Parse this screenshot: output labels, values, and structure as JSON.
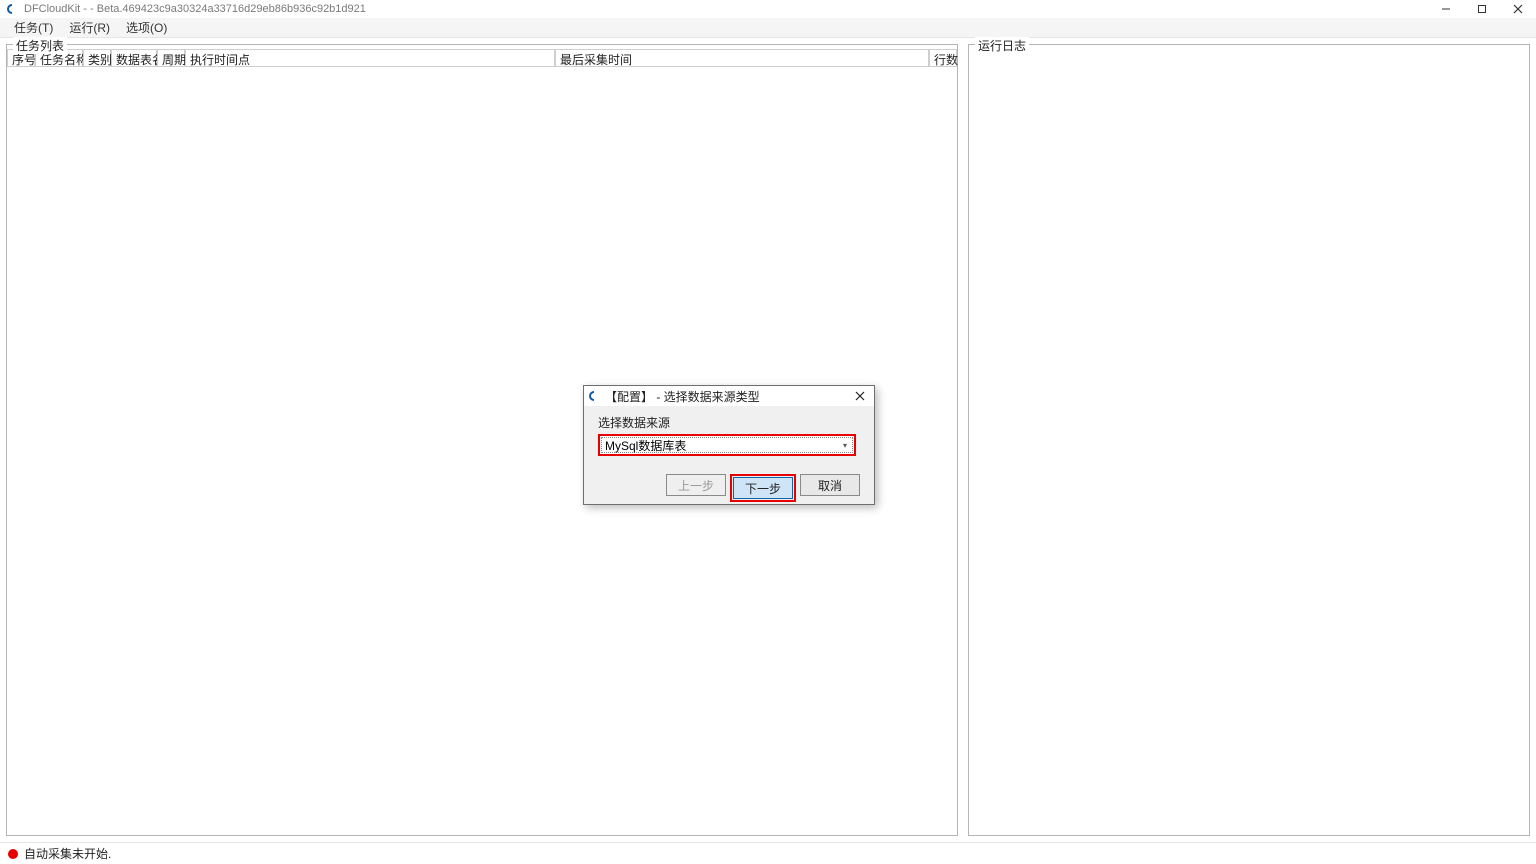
{
  "window": {
    "title": "DFCloudKit - - Beta.469423c9a30324a33716d29eb86b936c92b1d921"
  },
  "menu": {
    "tasks": "任务(T)",
    "run": "运行(R)",
    "options": "选项(O)"
  },
  "panels": {
    "task_list_label": "任务列表",
    "log_label": "运行日志"
  },
  "table": {
    "columns": {
      "seq": "序号",
      "name": "任务名称",
      "category": "类别",
      "data_table": "数据表名",
      "cycle": "周期",
      "exec_time": "执行时间点",
      "last_collect": "最后采集时间",
      "rows": "行数"
    }
  },
  "dialog": {
    "title": "【配置】 - 选择数据来源类型",
    "field_label": "选择数据来源",
    "selected": "MySql数据库表",
    "buttons": {
      "prev": "上一步",
      "next": "下一步",
      "cancel": "取消"
    }
  },
  "status": {
    "text": "自动采集未开始."
  }
}
